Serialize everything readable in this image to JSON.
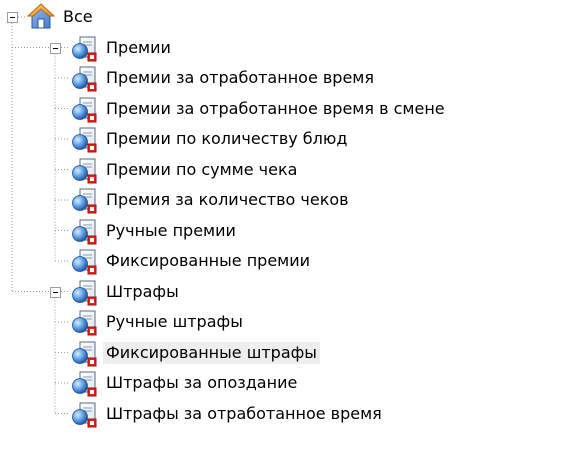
{
  "colors": {
    "tree_line": "#9a9a9a",
    "selection_background": "#eeeeee",
    "label_text": "#000000"
  },
  "tree": {
    "root": {
      "label": "Все",
      "icon": "house-icon",
      "expanded": true
    },
    "groups": [
      {
        "label": "Премии",
        "icon": "folder-document-icon",
        "expanded": true,
        "items": [
          {
            "label": "Премии за отработанное время",
            "icon": "document-icon"
          },
          {
            "label": "Премии за отработанное время в смене",
            "icon": "document-icon"
          },
          {
            "label": "Премии по количеству блюд",
            "icon": "document-icon"
          },
          {
            "label": "Премии по сумме чека",
            "icon": "document-icon"
          },
          {
            "label": "Премия за количество чеков",
            "icon": "document-icon"
          },
          {
            "label": "Ручные премии",
            "icon": "document-icon"
          },
          {
            "label": "Фиксированные премии",
            "icon": "document-icon"
          }
        ]
      },
      {
        "label": "Штрафы",
        "icon": "folder-document-icon",
        "expanded": true,
        "items": [
          {
            "label": "Ручные штрафы",
            "icon": "document-icon"
          },
          {
            "label": "Фиксированные штрафы",
            "icon": "document-icon",
            "selected": true
          },
          {
            "label": "Штрафы за опоздание",
            "icon": "document-icon"
          },
          {
            "label": "Штрафы за отработанное время",
            "icon": "document-icon"
          }
        ]
      }
    ]
  }
}
